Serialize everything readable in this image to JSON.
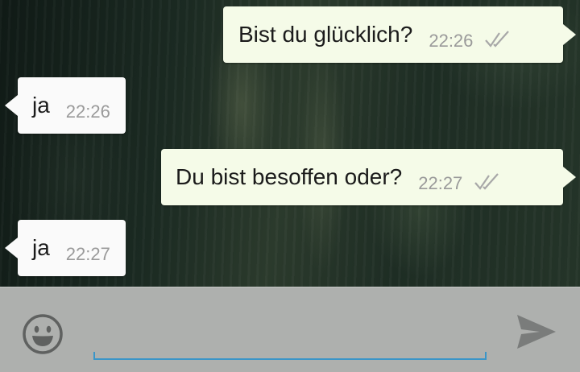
{
  "messages": [
    {
      "direction": "outgoing",
      "text": "Bist du glücklich?",
      "time": "22:26",
      "status_icon": "double-check-icon"
    },
    {
      "direction": "incoming",
      "text": "ja",
      "time": "22:26"
    },
    {
      "direction": "outgoing",
      "text": "Du bist besoffen oder?",
      "time": "22:27",
      "status_icon": "double-check-icon"
    },
    {
      "direction": "incoming",
      "text": "ja",
      "time": "22:27"
    }
  ],
  "input_bar": {
    "message_value": "",
    "emoji_icon": "emoji-icon",
    "send_icon": "send-icon"
  },
  "colors": {
    "outgoing_bubble": "#f5fbe8",
    "incoming_bubble": "#fafafa",
    "timestamp": "#9a9a9a",
    "input_bar_bg": "#aeb0ae",
    "input_underline": "#3a95c8"
  }
}
